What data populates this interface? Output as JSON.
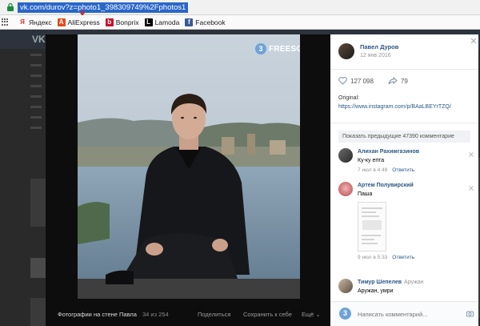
{
  "browser": {
    "url": "vk.com/durov?z=photo1_398309749%2Fphotos1"
  },
  "bookmarks": [
    {
      "label": "Яндекс",
      "icon": "yandex-icon",
      "color": "#ffffff",
      "fg": "#e52620",
      "glyph": "Я"
    },
    {
      "label": "AliExpress",
      "icon": "aliexpress-icon",
      "color": "#e8491d",
      "fg": "#ffffff",
      "glyph": "A"
    },
    {
      "label": "Bonprix",
      "icon": "bonprix-icon",
      "color": "#c8102e",
      "fg": "#ffffff",
      "glyph": "b"
    },
    {
      "label": "Lamoda",
      "icon": "lamoda-icon",
      "color": "#000000",
      "fg": "#ffffff",
      "glyph": "L"
    },
    {
      "label": "Facebook",
      "icon": "facebook-icon",
      "color": "#3b5998",
      "fg": "#ffffff",
      "glyph": "f"
    }
  ],
  "viewer": {
    "watermark": "FREESOFT.RU",
    "watermark_glyph": "3",
    "album_label": "Фотографии на стене Павла",
    "counter": "34 из 254",
    "share_label": "Поделиться",
    "save_label": "Сохранить к себе",
    "more_label": "Ещё ⌄"
  },
  "panel": {
    "author_name": "Павел Дуров",
    "author_date": "12 янв 2016",
    "likes_count": "127 098",
    "shares_count": "79",
    "original_label": "Original:",
    "original_link": "https://www.instagram.com/p/BAaLBEYrTZQ/",
    "more_comments": "Показать предыдущие 47390 комментарие",
    "comments": [
      {
        "name": "Алихан Рахимгазинов",
        "text": "Ку-ку епта",
        "date": "7 июл в 4:49",
        "reply": "Ответить"
      },
      {
        "name": "Артем Полувирский",
        "text": "Паша",
        "date": "9 июл в 5:33",
        "reply": "Ответить"
      },
      {
        "name": "Тимур Шепелев",
        "aside": "Аружан",
        "text": "Аружан, умри",
        "date": "",
        "reply": ""
      }
    ],
    "input_placeholder": "Написать комментарий..."
  },
  "colors": {
    "link": "#2a5885",
    "accent": "#6ea3d8",
    "url_highlight": "#2a66c9"
  }
}
